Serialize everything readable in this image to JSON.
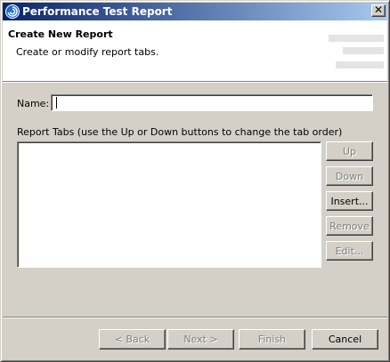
{
  "window": {
    "title": "Performance Test Report",
    "close_label": "✕",
    "icon": "app-swirl-icon"
  },
  "banner": {
    "title": "Create New Report",
    "description": "Create or modify report tabs."
  },
  "form": {
    "name_label": "Name:",
    "name_value": "",
    "tabs_label": "Report Tabs (use the Up or Down buttons to change the tab order)",
    "tabs_items": []
  },
  "side_buttons": {
    "up": "Up",
    "down": "Down",
    "insert": "Insert...",
    "remove": "Remove",
    "edit": "Edit..."
  },
  "footer_buttons": {
    "back": "< Back",
    "next": "Next >",
    "finish": "Finish",
    "cancel": "Cancel"
  },
  "colors": {
    "titlebar_start": "#0a246a",
    "titlebar_end": "#a6caf0",
    "face": "#d4d0c8"
  }
}
